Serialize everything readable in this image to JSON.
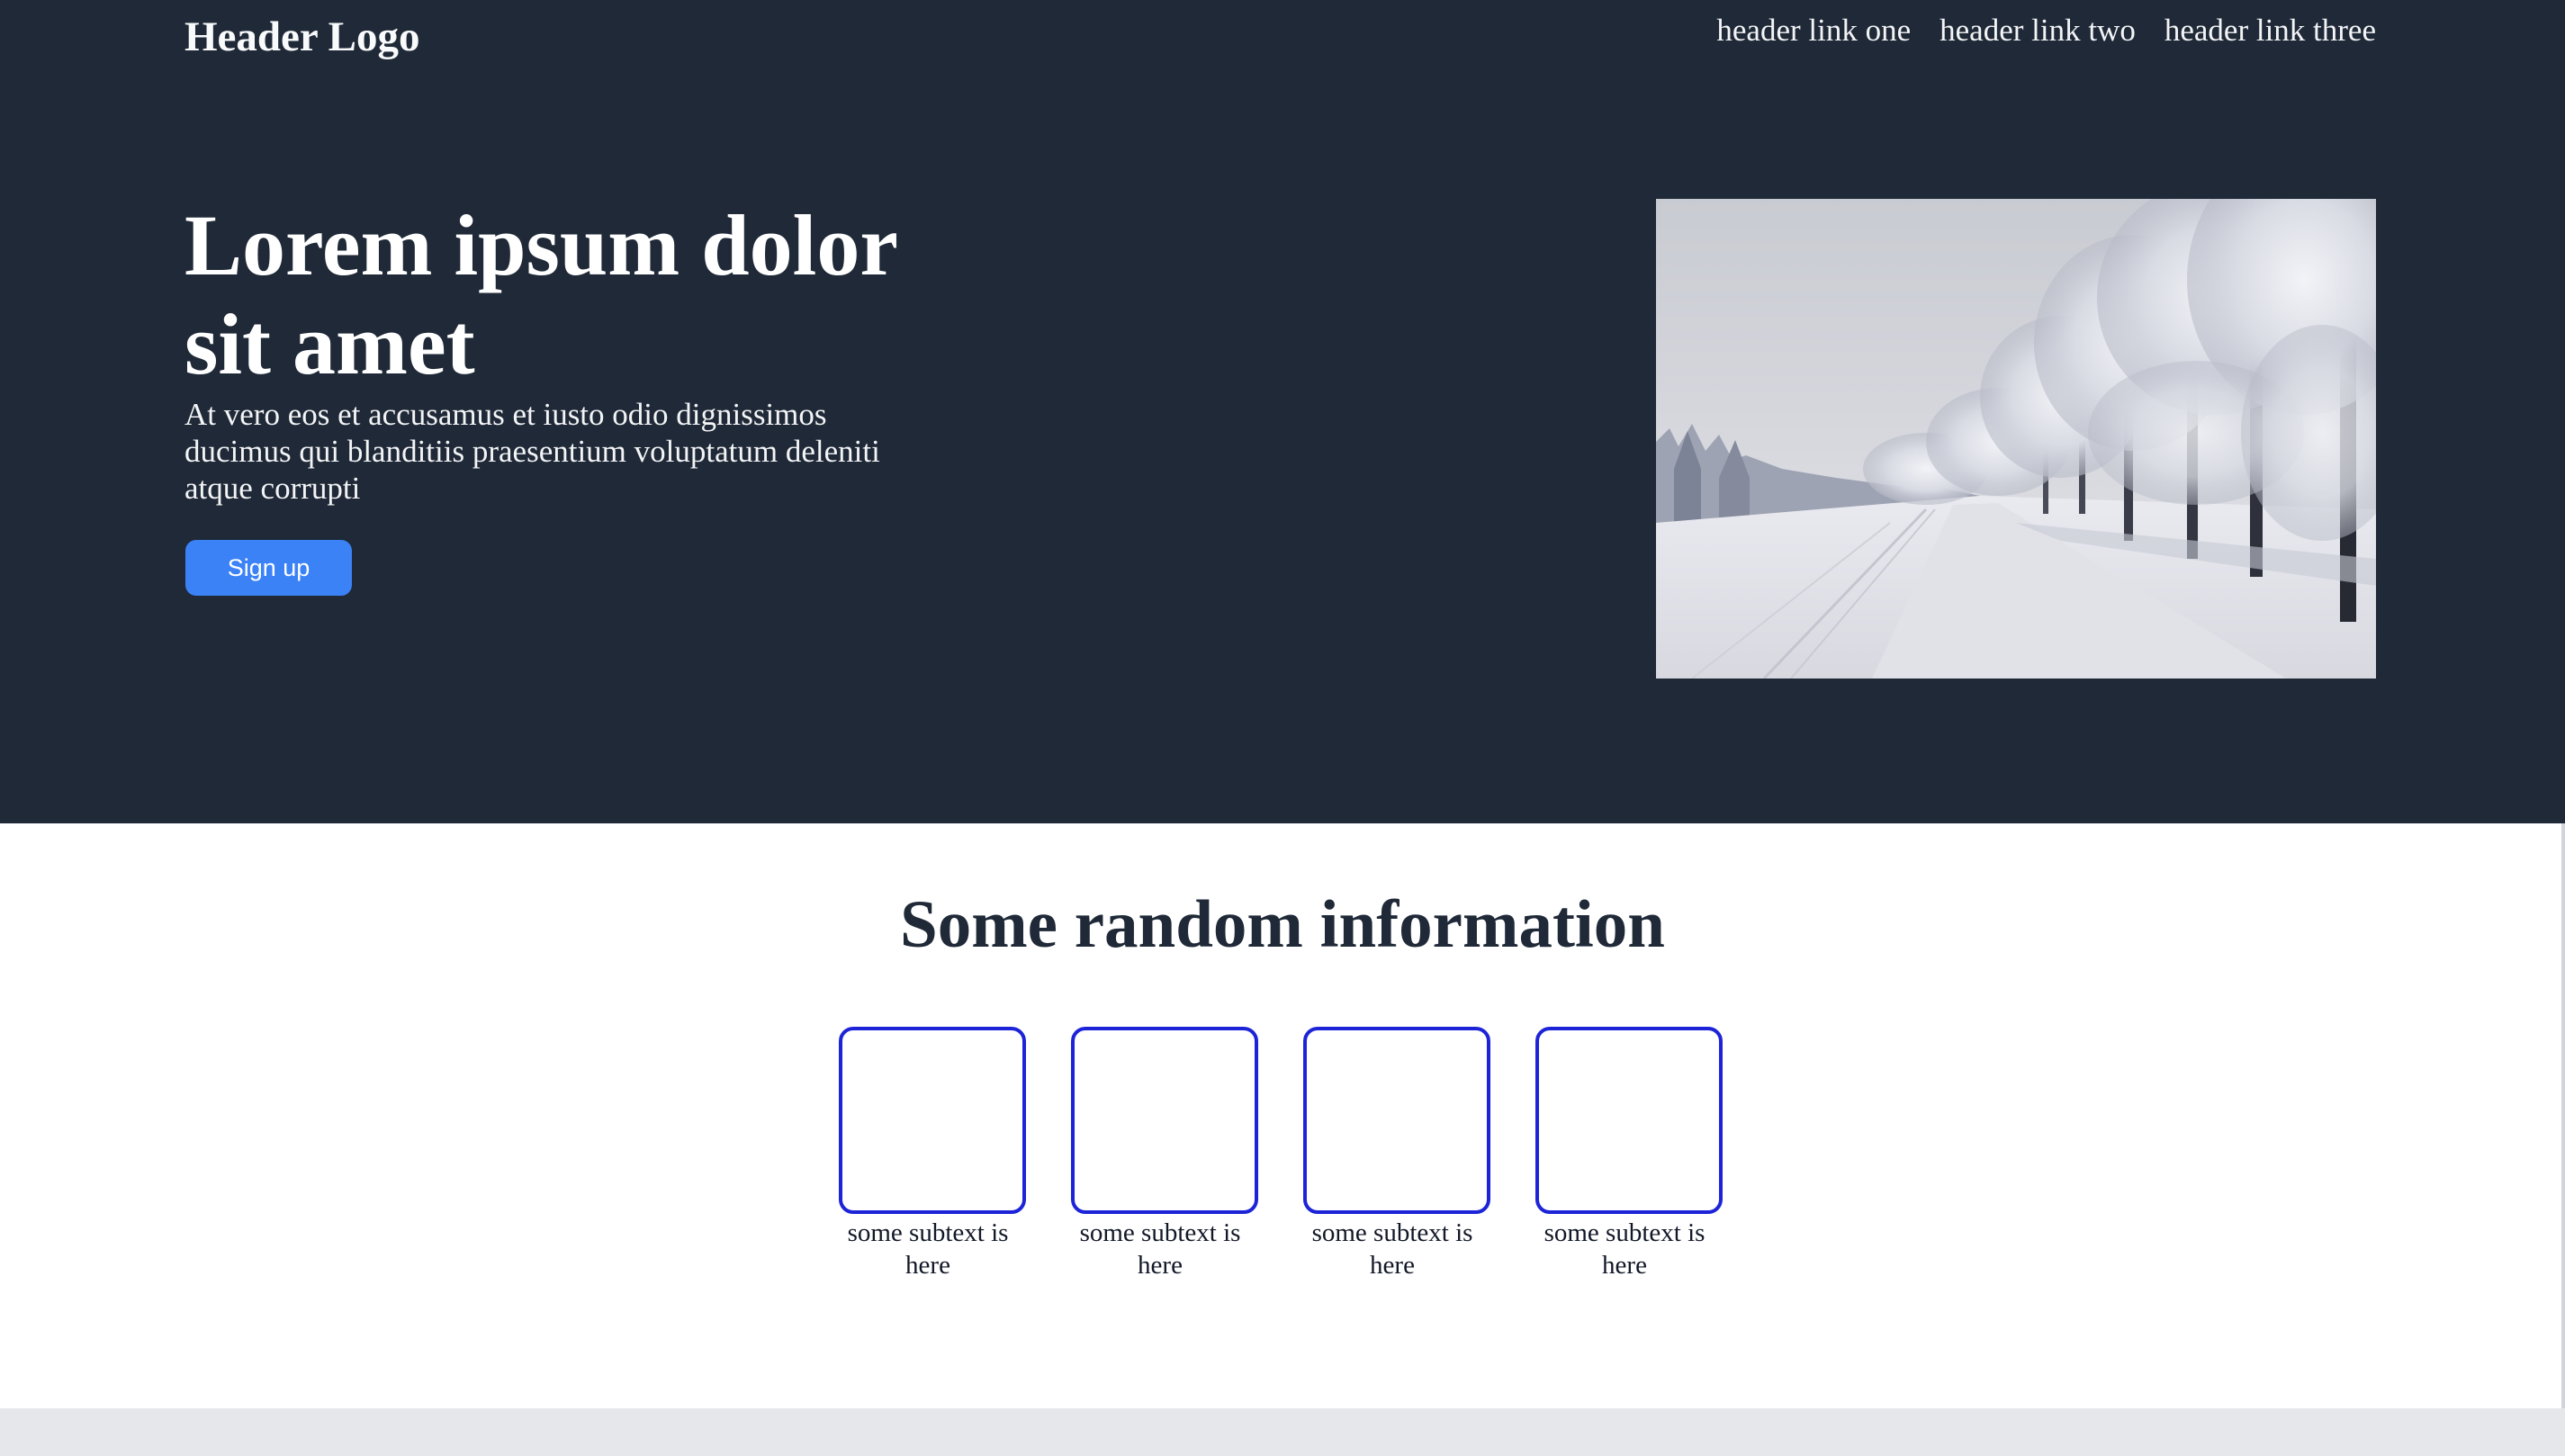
{
  "header": {
    "logo": "Header Logo",
    "links": [
      "header link one",
      "header link two",
      "header link three"
    ]
  },
  "hero": {
    "title": "Lorem ipsum dolor sit amet",
    "text": "At vero eos et accusamus et iusto odio dignissimos ducimus qui blanditiis praesentium voluptatum deleniti atque corrupti",
    "button_label": "Sign up",
    "image_subject": "snow-covered trees along a snowy road"
  },
  "info": {
    "title": "Some random information",
    "cards": [
      {
        "caption": "some subtext is here"
      },
      {
        "caption": "some subtext is here"
      },
      {
        "caption": "some subtext is here"
      },
      {
        "caption": "some subtext is here"
      }
    ]
  },
  "colors": {
    "hero_background": "#1f2937",
    "button": "#3b82f6",
    "card_border": "#1d24d8",
    "footer_background": "#e5e7eb"
  }
}
